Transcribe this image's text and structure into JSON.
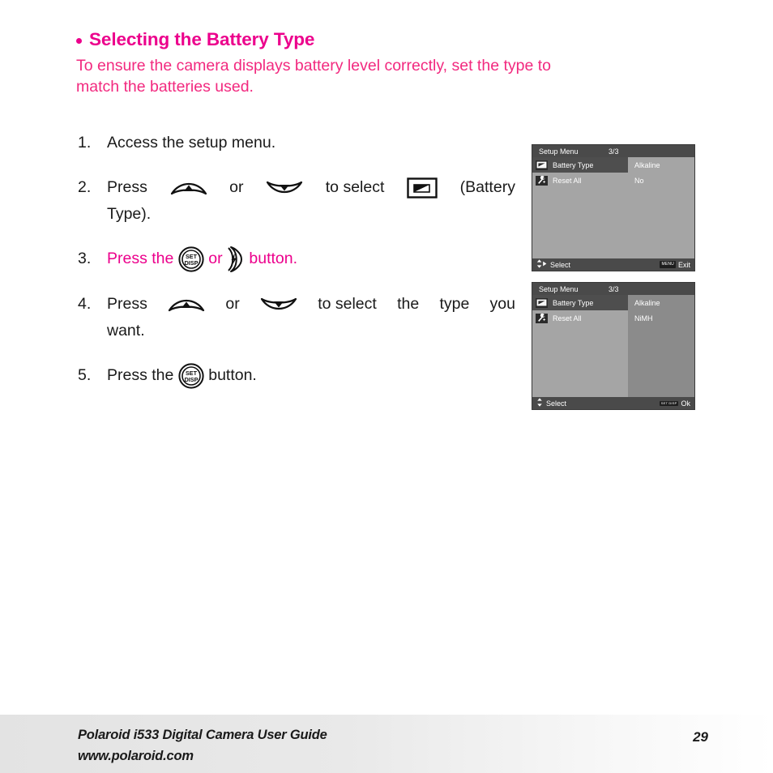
{
  "section": {
    "bullet": "•",
    "title": "Selecting the Battery Type",
    "description_line1": "To ensure the camera displays battery level correctly, set the type to",
    "description_line2": "match the batteries used."
  },
  "steps": [
    {
      "number": "1.",
      "text": "Access the setup menu."
    },
    {
      "number": "2.",
      "press": "Press",
      "or": "or",
      "to_select": "to select",
      "target": "(Battery",
      "line2": "Type).",
      "icons": [
        "up-rocker-icon",
        "down-rocker-icon",
        "battery-type-icon"
      ]
    },
    {
      "number": "3.",
      "press_the": "Press the",
      "or": "or",
      "button": "button.",
      "icons": [
        "set-disp-button-icon",
        "flash-right-button-icon"
      ],
      "color": "#ec008c"
    },
    {
      "number": "4.",
      "press": "Press",
      "or": "or",
      "to_select": "to select",
      "the": "the",
      "type": "type",
      "you": "you",
      "line2": "want.",
      "icons": [
        "up-rocker-icon",
        "down-rocker-icon"
      ]
    },
    {
      "number": "5.",
      "press_the": "Press the",
      "button": "button.",
      "icons": [
        "set-disp-button-icon"
      ]
    }
  ],
  "lcd_screens": [
    {
      "title": "Setup Menu",
      "page": "3/3",
      "rows": [
        {
          "label": "Battery Type",
          "value": "Alkaline",
          "selected": true,
          "icon": "battery-icon"
        },
        {
          "label": "Reset All",
          "value": "No",
          "selected": false,
          "icon": "reset-wrench-icon"
        }
      ],
      "footer": {
        "select": "Select",
        "action_key": "MENU",
        "action_label": "Exit"
      },
      "nav_arrows": "up-down-right"
    },
    {
      "title": "Setup Menu",
      "page": "3/3",
      "rows": [
        {
          "label": "Battery Type",
          "value": "Alkaline",
          "selected": true,
          "icon": "battery-icon"
        },
        {
          "label": "Reset All",
          "value": "NiMH",
          "selected": false,
          "icon": "reset-wrench-icon"
        }
      ],
      "footer": {
        "select": "Select",
        "action_key": "SET DISP",
        "action_label": "Ok"
      },
      "nav_arrows": "up-down"
    }
  ],
  "footer": {
    "line1": "Polaroid i533 Digital Camera User Guide",
    "line2": "www.polaroid.com",
    "page_number": "29"
  },
  "colors": {
    "accent_pink": "#ec008c",
    "body_pink": "#f2297f",
    "text_black": "#1a1a1a",
    "lcd_bar": "#4a4a4a",
    "lcd_panel": "#a5a5a5",
    "lcd_panel_dark": "#8b8b8b",
    "lcd_selected": "#4e4e4e"
  }
}
